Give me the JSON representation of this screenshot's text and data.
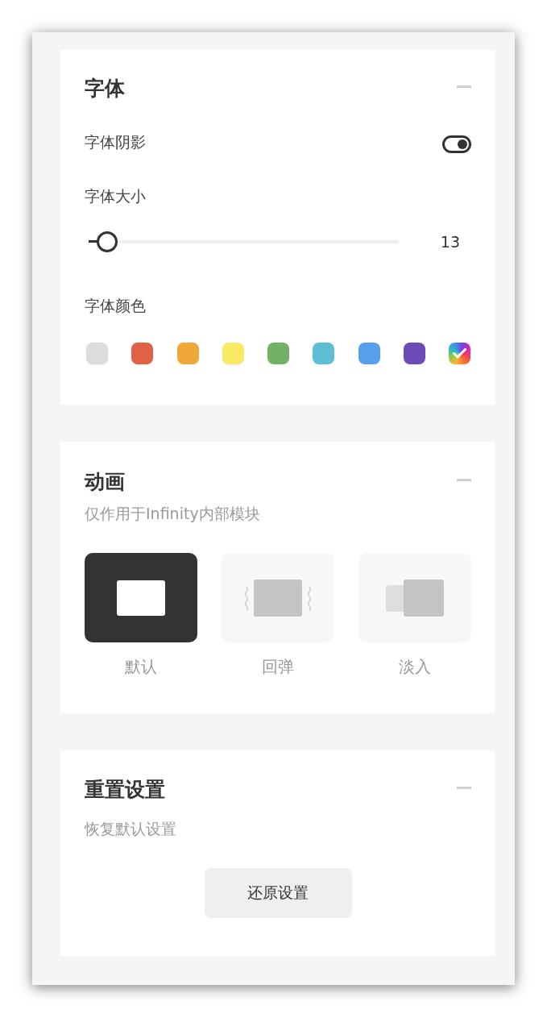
{
  "font": {
    "title": "字体",
    "shadow": {
      "label": "字体阴影",
      "on": true
    },
    "size": {
      "label": "字体大小",
      "level": 0.06,
      "reading": "13"
    },
    "color": {
      "label": "字体颜色",
      "swatches": [
        {
          "kind": "solid",
          "color": "#dcdcdc",
          "selected": false
        },
        {
          "kind": "solid",
          "color": "#e06048",
          "selected": false
        },
        {
          "kind": "solid",
          "color": "#eda838",
          "selected": false
        },
        {
          "kind": "solid",
          "color": "#f9ea66",
          "selected": false
        },
        {
          "kind": "solid",
          "color": "#73b266",
          "selected": false
        },
        {
          "kind": "solid",
          "color": "#5ebfd4",
          "selected": false
        },
        {
          "kind": "solid",
          "color": "#579eec",
          "selected": false
        },
        {
          "kind": "solid",
          "color": "#6b4cb8",
          "selected": false
        },
        {
          "kind": "gradient",
          "selected": true
        }
      ]
    }
  },
  "animation": {
    "title": "动画",
    "subtitle": "仅作用于Infinity内部模块",
    "options": [
      {
        "kind": "default",
        "label": "默认",
        "selected": true
      },
      {
        "kind": "bounce",
        "label": "回弹",
        "selected": false
      },
      {
        "kind": "fade",
        "label": "淡入",
        "selected": false
      }
    ]
  },
  "reset": {
    "title": "重置设置",
    "subtitle": "恢复默认设置",
    "button": "还原设置"
  }
}
